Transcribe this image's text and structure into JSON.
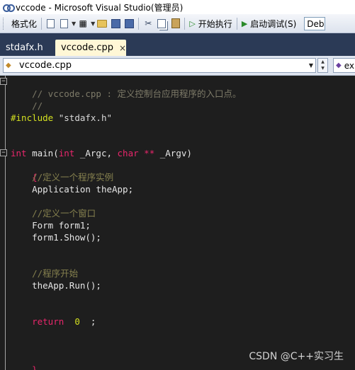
{
  "window": {
    "title": "vccode - Microsoft Visual Studio(管理员)"
  },
  "toolbar": {
    "format_label": "格式化",
    "start_label": "开始执行",
    "debug_label": "启动调试(S)",
    "config_value": "Deb"
  },
  "tabs": [
    {
      "label": "stdafx.h",
      "active": false
    },
    {
      "label": "vccode.cpp",
      "active": true,
      "close": "×"
    }
  ],
  "nav": {
    "scope": "vccode.cpp",
    "member": "ex"
  },
  "code": {
    "l1": "// vccode.cpp : 定义控制台应用程序的入口点。",
    "l2": "//",
    "include_kw": "#include",
    "include_file": "\"stdafx.h\"",
    "main_int": "int",
    "main_name": " main(",
    "arg_int": "int",
    "arg_argc": " _Argc, ",
    "arg_char": "char",
    "arg_ptr": " **",
    "arg_argv": " _Argv)",
    "brace_open": "{",
    "c_instance": "//定义一个程序实例",
    "app_line": "Application theApp;",
    "c_window": "//定义一个窗口",
    "form_line": "Form form1;",
    "form_show": "form1.Show();",
    "c_start": "//程序开始",
    "run_line": "theApp.Run();",
    "ret_kw": "return",
    "ret_val": "0",
    "ret_semi": ";",
    "brace_close": "}"
  },
  "watermark": "CSDN @C++实习生"
}
